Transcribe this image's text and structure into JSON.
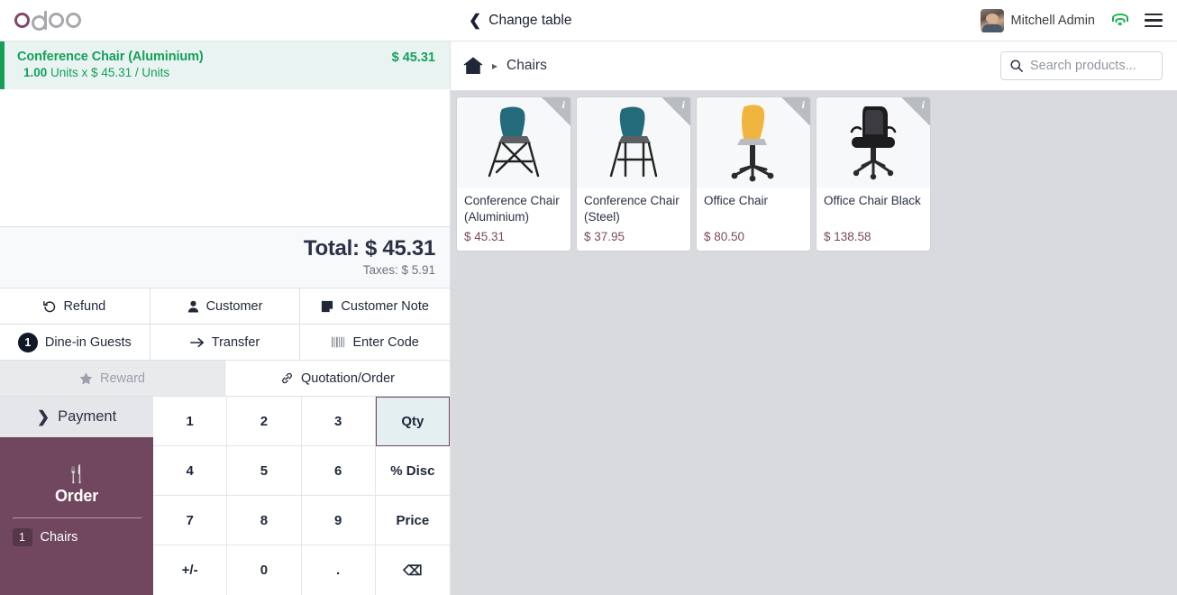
{
  "topbar": {
    "logo": "odoo",
    "change_table_label": "Change table",
    "back_icon": "chevron-left-icon",
    "user_name": "Mitchell Admin",
    "wifi_icon": "wifi-icon",
    "menu_icon": "hamburger-menu-icon"
  },
  "order": {
    "lines": [
      {
        "name": "Conference Chair (Aluminium)",
        "qty": "1.00",
        "detail": "Units x $ 45.31 / Units",
        "price": "$ 45.31",
        "selected": true
      }
    ],
    "total_label": "Total: $ 45.31",
    "taxes_label": "Taxes: $ 5.91"
  },
  "actions": {
    "row1": [
      {
        "label": "Refund",
        "icon": "refund-icon",
        "disabled": false
      },
      {
        "label": "Customer",
        "icon": "user-icon",
        "disabled": false
      },
      {
        "label": "Customer Note",
        "icon": "note-icon",
        "disabled": false
      }
    ],
    "row2": [
      {
        "label": "Dine-in Guests",
        "icon": "guest-count-badge",
        "badge": "1",
        "disabled": false
      },
      {
        "label": "Transfer",
        "icon": "arrow-right-icon",
        "disabled": false
      },
      {
        "label": "Enter Code",
        "icon": "barcode-icon",
        "disabled": false
      }
    ],
    "row3": [
      {
        "label": "Reward",
        "icon": "star-icon",
        "disabled": true
      },
      {
        "label": "Quotation/Order",
        "icon": "link-icon",
        "disabled": false
      }
    ]
  },
  "payment": {
    "label": "Payment",
    "icon": "chevron-right-icon"
  },
  "order_panel": {
    "icon": "utensils-icon",
    "title": "Order",
    "categories": [
      {
        "count": "1",
        "name": "Chairs"
      }
    ],
    "bg_color": "#71475f"
  },
  "numpad": {
    "keys": [
      {
        "label": "1",
        "type": "digit",
        "selected": false
      },
      {
        "label": "2",
        "type": "digit",
        "selected": false
      },
      {
        "label": "3",
        "type": "digit",
        "selected": false
      },
      {
        "label": "Qty",
        "type": "mode",
        "selected": true
      },
      {
        "label": "4",
        "type": "digit",
        "selected": false
      },
      {
        "label": "5",
        "type": "digit",
        "selected": false
      },
      {
        "label": "6",
        "type": "digit",
        "selected": false
      },
      {
        "label": "% Disc",
        "type": "mode",
        "selected": false
      },
      {
        "label": "7",
        "type": "digit",
        "selected": false
      },
      {
        "label": "8",
        "type": "digit",
        "selected": false
      },
      {
        "label": "9",
        "type": "digit",
        "selected": false
      },
      {
        "label": "Price",
        "type": "mode",
        "selected": false
      },
      {
        "label": "+/-",
        "type": "sign",
        "selected": false
      },
      {
        "label": "0",
        "type": "digit",
        "selected": false
      },
      {
        "label": ".",
        "type": "digit",
        "selected": false
      },
      {
        "label": "⌫",
        "type": "backspace",
        "selected": false
      }
    ],
    "selected_mode": "Qty",
    "selected_color": "#e3eff0",
    "selected_border": "#71475f"
  },
  "products_header": {
    "home_icon": "home-icon",
    "separator": "▸",
    "category": "Chairs",
    "search_icon": "search-icon",
    "search_value": "",
    "search_placeholder": "Search products..."
  },
  "products": [
    {
      "name": "Conference Chair (Aluminium)",
      "price": "$ 45.31",
      "info_icon": "info-icon",
      "image": "chair-teal-aluminium"
    },
    {
      "name": "Conference Chair (Steel)",
      "price": "$ 37.95",
      "info_icon": "info-icon",
      "image": "chair-teal-steel"
    },
    {
      "name": "Office Chair",
      "price": "$ 80.50",
      "info_icon": "info-icon",
      "image": "chair-yellow-swivel"
    },
    {
      "name": "Office Chair Black",
      "price": "$ 138.58",
      "info_icon": "info-icon",
      "image": "chair-black-mesh"
    }
  ]
}
